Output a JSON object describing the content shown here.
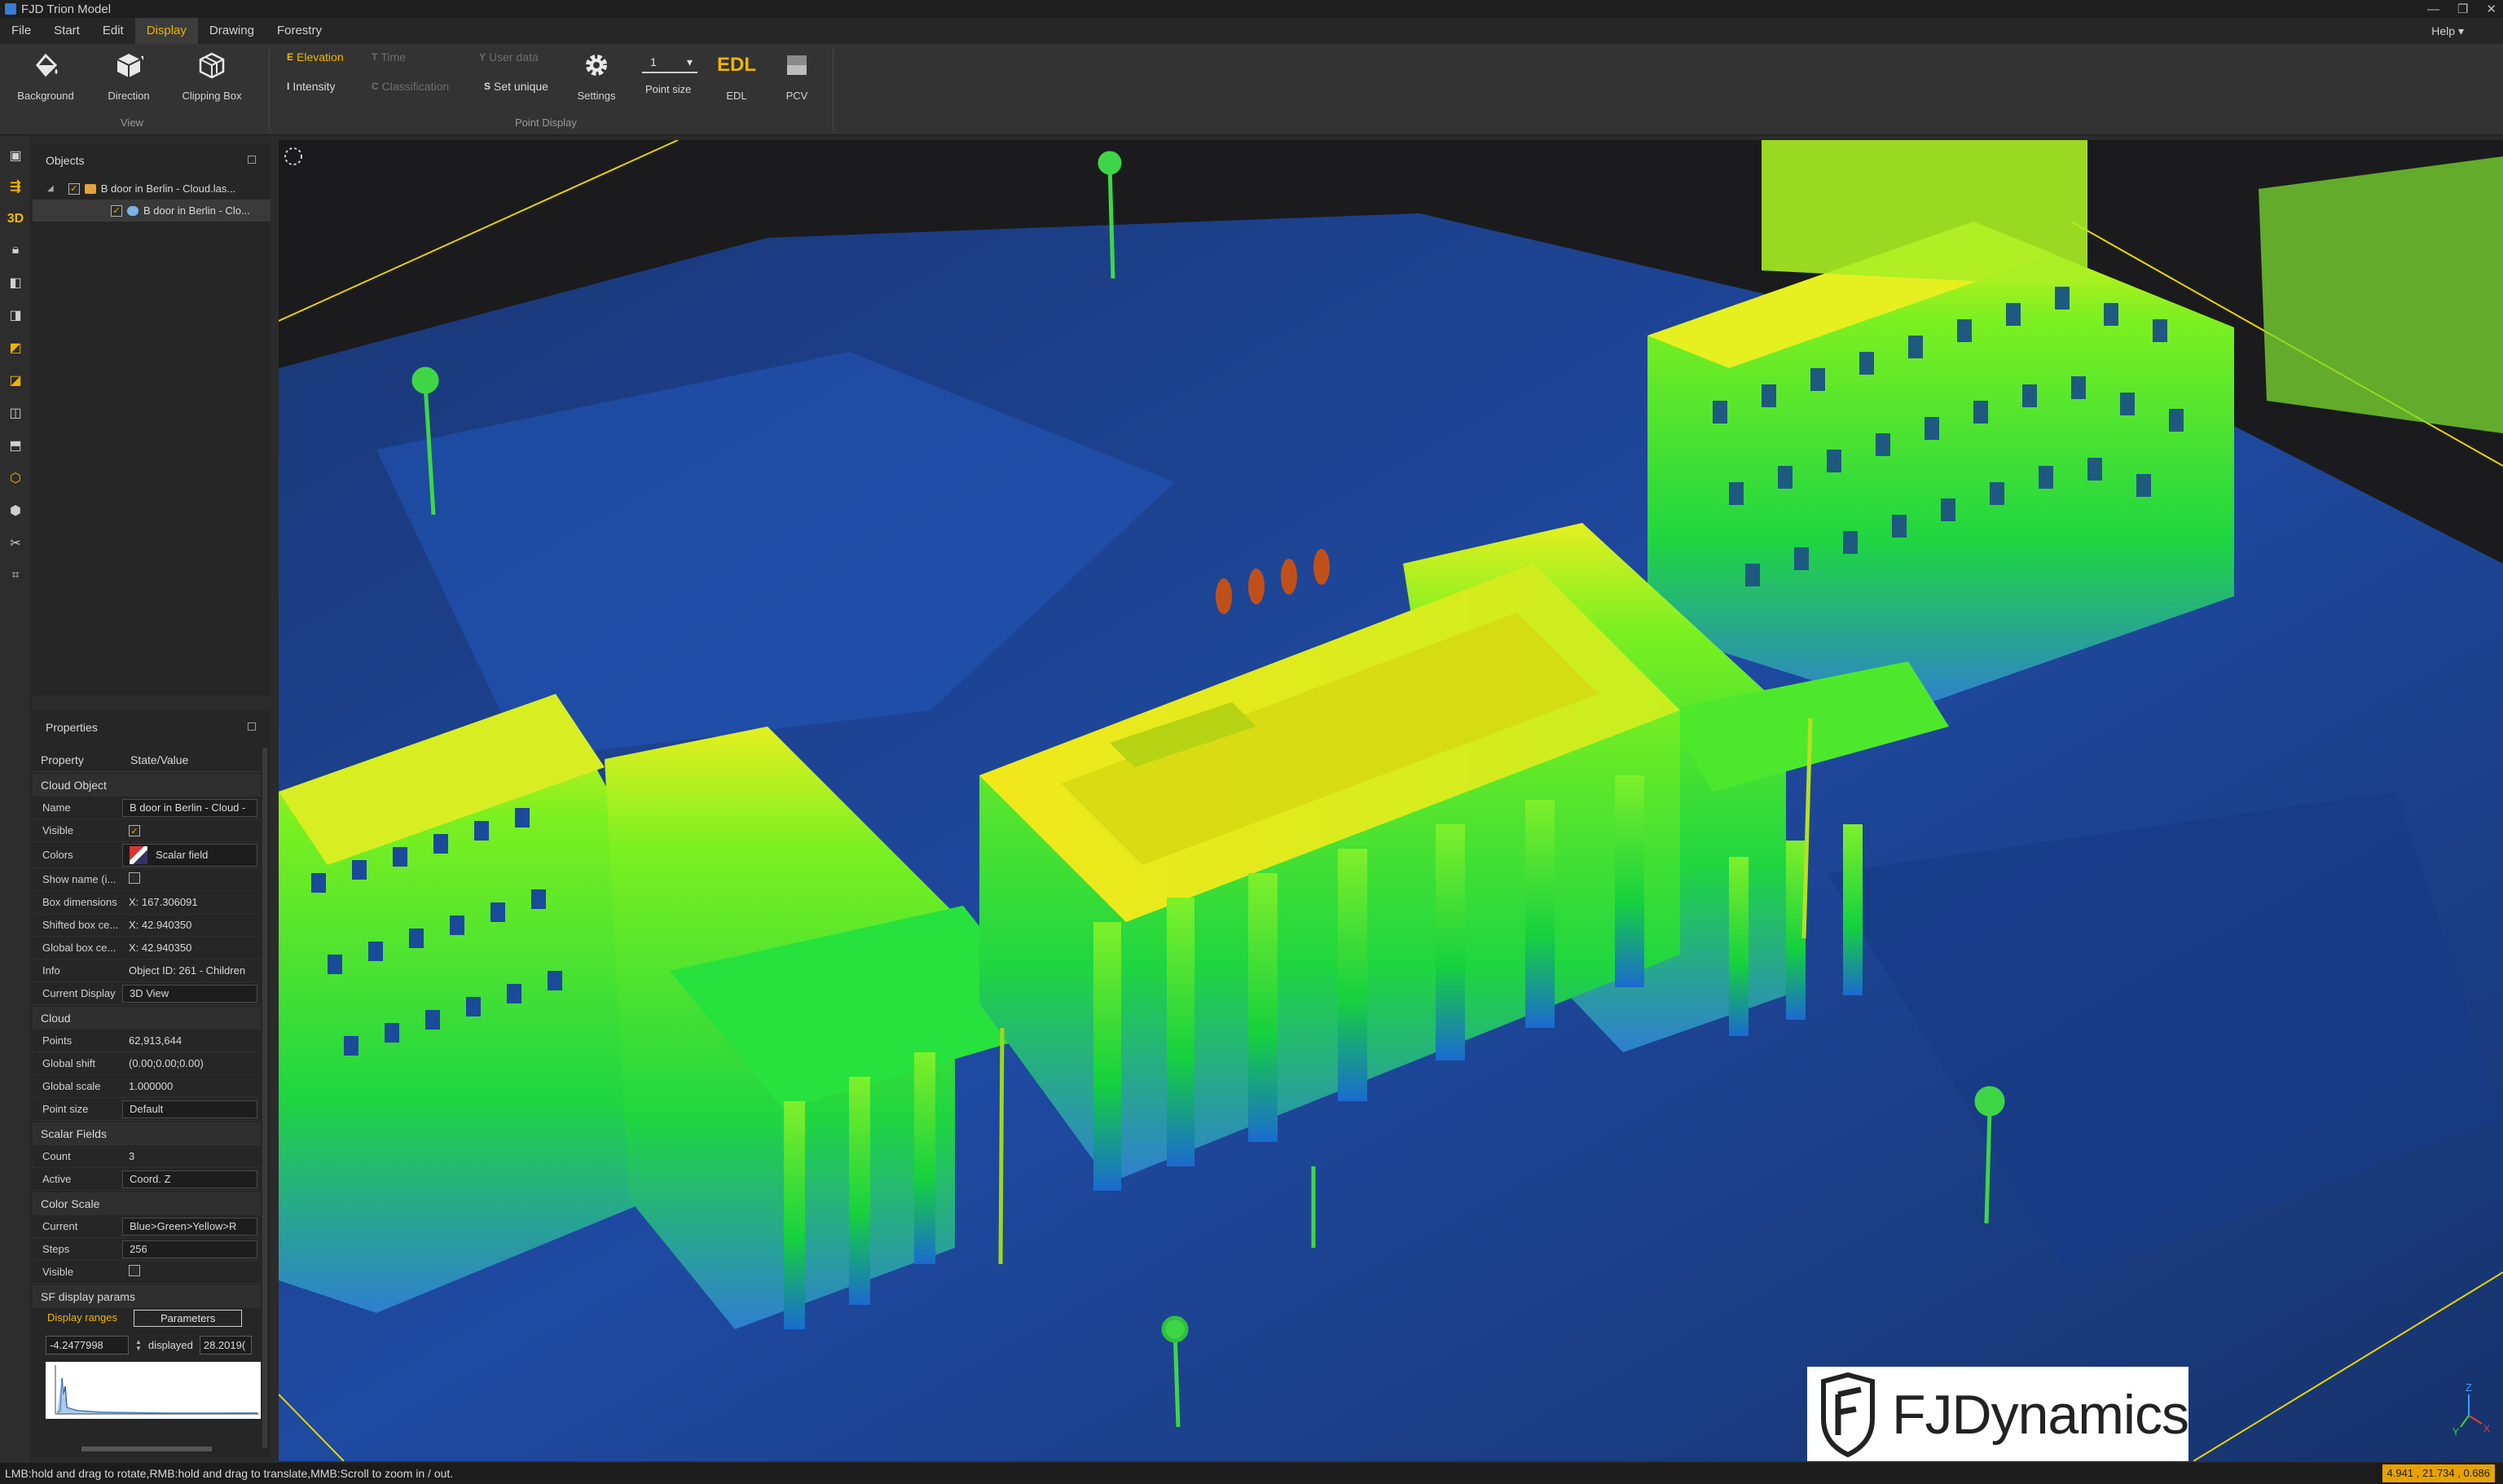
{
  "window": {
    "title": "FJD Trion Model",
    "controls": [
      "—",
      "❐",
      "✕"
    ]
  },
  "menu": {
    "items": [
      "File",
      "Start",
      "Edit",
      "Display",
      "Drawing",
      "Forestry"
    ],
    "active": "Display",
    "help": "Help"
  },
  "ribbon": {
    "view_buttons": [
      "Background",
      "Direction",
      "Clipping Box"
    ],
    "view_group": "View",
    "elevation": "Elevation",
    "time": "Time",
    "user_data": "User data",
    "intensity": "Intensity",
    "classification": "Classification",
    "set_unique": "Set unique",
    "settings": "Settings",
    "point_size_value": "1",
    "point_size": "Point size",
    "edl_text": "EDL",
    "edl": "EDL",
    "pcv": "PCV",
    "point_display_group": "Point Display",
    "badges": {
      "elevation": "E",
      "time": "T",
      "user_data": "Y",
      "intensity": "I",
      "classification": "C",
      "set_unique": "S"
    }
  },
  "left_tools": {
    "three_d": "3D"
  },
  "objects": {
    "title": "Objects",
    "items": [
      {
        "label": "B door in Berlin - Cloud.las..."
      },
      {
        "label": "B door in Berlin - Clo..."
      }
    ]
  },
  "properties": {
    "title": "Properties",
    "col_property": "Property",
    "col_value": "State/Value",
    "sections": {
      "cloud_object": "Cloud Object",
      "cloud": "Cloud",
      "scalar_fields": "Scalar Fields",
      "color_scale": "Color Scale",
      "sf_display": "SF display params"
    },
    "rows": {
      "name": [
        "Name",
        "B door in Berlin - Cloud -"
      ],
      "visible": [
        "Visible",
        ""
      ],
      "colors": [
        "Colors",
        "Scalar field"
      ],
      "show_name": [
        "Show name (i...",
        ""
      ],
      "box_dims": [
        "Box dimensions",
        "X: 167.306091"
      ],
      "shifted_box": [
        "Shifted box ce...",
        "X: 42.940350"
      ],
      "global_box": [
        "Global box ce...",
        "X: 42.940350"
      ],
      "info": [
        "Info",
        "Object ID: 261 - Children"
      ],
      "current_display": [
        "Current Display",
        "3D View"
      ],
      "points": [
        "Points",
        "62,913,644"
      ],
      "global_shift": [
        "Global shift",
        "(0.00;0.00;0.00)"
      ],
      "global_scale": [
        "Global scale",
        "1.000000"
      ],
      "point_size": [
        "Point size",
        "Default"
      ],
      "count": [
        "Count",
        "3"
      ],
      "active": [
        "Active",
        "Coord. Z"
      ],
      "current": [
        "Current",
        "Blue>Green>Yellow>R"
      ],
      "steps": [
        "Steps",
        "256"
      ],
      "visible2": [
        "Visible",
        ""
      ]
    },
    "tabs": {
      "ranges": "Display ranges",
      "params": "Parameters"
    },
    "range_min": "-4.2477998",
    "range_label": "displayed",
    "range_max": "28.2019("
  },
  "watermark": {
    "brand": "FJDynamics"
  },
  "axis_labels": {
    "z": "Z",
    "x": "X",
    "y": "Y"
  },
  "status": {
    "hint": "LMB:hold and drag to rotate,RMB:hold and drag to translate,MMB:Scroll to zoom in / out.",
    "coords": "4.941 , 21.734 , 0.686"
  },
  "colors": {
    "accent": "#f0b400",
    "background": "#2b2b2b",
    "viewport": "#1b1b1d"
  }
}
